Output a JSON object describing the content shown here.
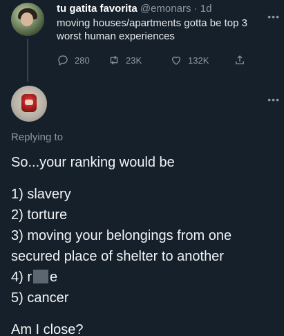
{
  "original_tweet": {
    "display_name": "tu gatita favorita",
    "handle": "@emonars",
    "time": "· 1d",
    "text": "moving houses/apartments gotta be top 3 worst human experiences",
    "stats": {
      "replies": "280",
      "retweets": "23K",
      "likes": "132K"
    },
    "icons": [
      "reply-icon",
      "retweet-icon",
      "like-icon",
      "share-icon",
      "more-icon"
    ]
  },
  "reply": {
    "replying_to": "Replying to",
    "lines": [
      "So...your ranking would be",
      "1) slavery",
      "2) torture",
      "3) moving your belongings from one",
      "secured place of shelter to another",
      "4) r",
      "e",
      "5) cancer",
      "Am I close?"
    ]
  },
  "colors": {
    "background": "#15202b",
    "text": "#e7e9ea",
    "muted": "#8b98a5"
  }
}
